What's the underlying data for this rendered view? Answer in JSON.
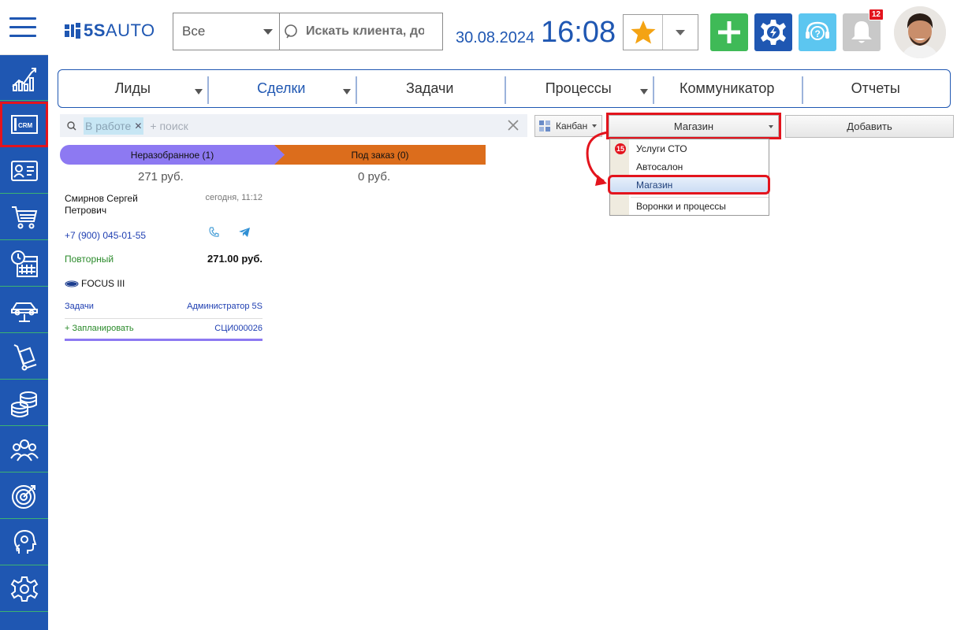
{
  "app": {
    "logo_text_bold": "5S",
    "logo_text_rest": "AUTO"
  },
  "search": {
    "scope_value": "Все",
    "placeholder": "Искать клиента, до"
  },
  "clock": {
    "date": "30.08.2024",
    "time": "16:08"
  },
  "notifications": {
    "count": "12"
  },
  "sidebar": {
    "items": [
      {
        "name": "analytics-icon"
      },
      {
        "name": "crm-icon",
        "label": "CRM",
        "active": true
      },
      {
        "name": "contacts-icon"
      },
      {
        "name": "cart-icon"
      },
      {
        "name": "calendar-icon"
      },
      {
        "name": "car-lift-icon"
      },
      {
        "name": "parts-icon"
      },
      {
        "name": "finance-icon"
      },
      {
        "name": "team-icon"
      },
      {
        "name": "target-icon"
      },
      {
        "name": "support-icon"
      },
      {
        "name": "settings-icon"
      }
    ]
  },
  "nav": {
    "tabs": [
      {
        "label": "Лиды",
        "dropdown": true
      },
      {
        "label": "Сделки",
        "dropdown": true,
        "active": true
      },
      {
        "label": "Задачи",
        "dropdown": false
      },
      {
        "label": "Процессы",
        "dropdown": true
      },
      {
        "label": "Коммуникатор",
        "dropdown": false
      },
      {
        "label": "Отчеты",
        "dropdown": false
      }
    ]
  },
  "filter": {
    "chip": "В работе",
    "placeholder": "+ поиск"
  },
  "toolbar": {
    "view_label": "Канбан",
    "funnel_value": "Магазин",
    "add_label": "Добавить"
  },
  "funnel_dropdown": {
    "items": [
      {
        "label": "Услуги СТО",
        "badge": "15"
      },
      {
        "label": "Автосалон"
      },
      {
        "label": "Магазин",
        "selected": true
      },
      {
        "label": "Воронки и процессы"
      }
    ]
  },
  "kanban": {
    "columns": [
      {
        "title": "Неразобранное (1)",
        "sum": "271 руб.",
        "color": "#8d79f2"
      },
      {
        "title": "Под заказ (0)",
        "sum": "0 руб.",
        "color": "#dc6d1c"
      }
    ],
    "card": {
      "client": "Смирнов Сергей Петрович",
      "date": "сегодня, 11:12",
      "phone": "+7 (900) 045-01-55",
      "status": "Повторный",
      "amount": "271.00 руб.",
      "car": "FOCUS III",
      "tasks_label": "Задачи",
      "assignee": "Администратор 5S",
      "plan_label": "+ Запланировать",
      "code": "СЦИ000026"
    }
  },
  "colors": {
    "brand": "#1f57b2",
    "accent_red": "#e3141d",
    "green": "#3fba57"
  }
}
